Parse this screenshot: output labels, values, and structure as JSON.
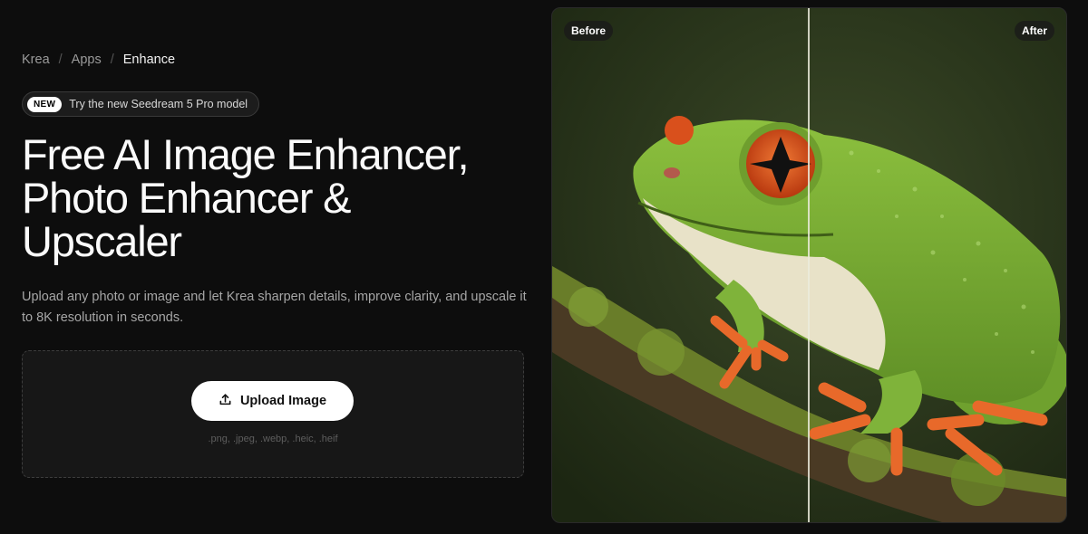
{
  "breadcrumb": {
    "items": [
      "Krea",
      "Apps",
      "Enhance"
    ],
    "separator": "/"
  },
  "promo": {
    "badge": "NEW",
    "text": "Try the new Seedream 5 Pro model"
  },
  "hero": {
    "title_line1": "Free AI Image Enhancer,",
    "title_line2": "Photo Enhancer &",
    "title_line3": "Upscaler",
    "description": "Upload any photo or image and let Krea sharpen details, improve clarity, and upscale it to 8K resolution in seconds."
  },
  "upload": {
    "button_label": "Upload Image",
    "icon": "upload-icon",
    "formats": ".png, .jpeg, .webp, .heic, .heif"
  },
  "comparison": {
    "before_label": "Before",
    "after_label": "After",
    "image_subject": "green frog on mossy branch"
  },
  "colors": {
    "background": "#0d0d0d",
    "button_bg": "#ffffff",
    "frog_green": "#7fb33a",
    "eye_orange": "#e0581e"
  }
}
